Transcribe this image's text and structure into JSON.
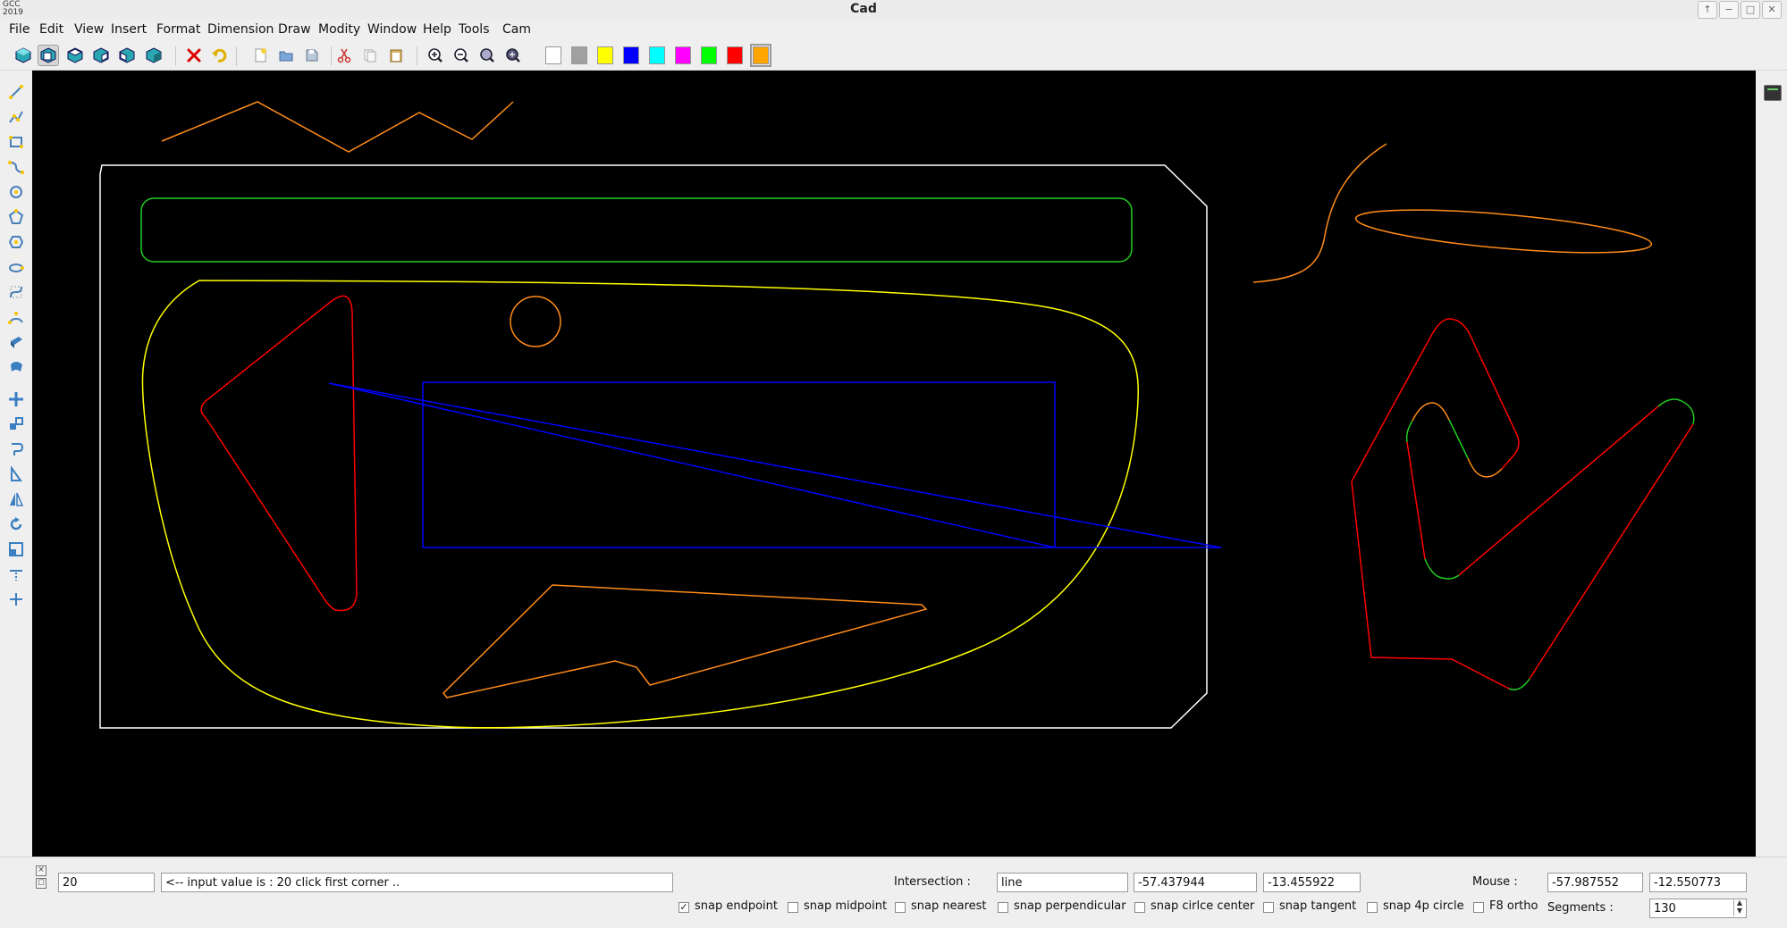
{
  "app": {
    "logo_top": "GCC",
    "logo_bottom": "2019",
    "title": "Cad"
  },
  "window_controls": [
    "↑",
    "−",
    "□",
    "✕"
  ],
  "menu": [
    "File",
    "Edit",
    "View",
    "Insert",
    "Format",
    "Dimension",
    "Draw",
    "Modity",
    "Window",
    "Help",
    "Tools",
    "Cam"
  ],
  "toolbar": {
    "view_icons": [
      "view-3d-icon",
      "view-front-icon",
      "view-top-icon",
      "view-right-icon",
      "view-left-icon",
      "view-iso-icon"
    ],
    "edit_icons": [
      "delete-icon",
      "undo-icon",
      "new-file-icon",
      "open-file-icon",
      "save-file-icon",
      "cut-icon",
      "copy-icon",
      "paste-icon"
    ],
    "zoom_icons": [
      "zoom-in-icon",
      "zoom-out-icon",
      "zoom-window-icon",
      "zoom-extents-icon"
    ],
    "colors": [
      "#ffffff",
      "#a0a0a0",
      "#ffff00",
      "#0000ff",
      "#00ffff",
      "#ff00ff",
      "#00ff00",
      "#ff0000",
      "#ffa500"
    ],
    "selected_color": "#ffa500"
  },
  "left_tools": [
    "line-icon",
    "polyline-icon",
    "rectangle-icon",
    "spline-icon",
    "circle-icon",
    "polygon-icon",
    "hexagon-icon",
    "ellipse-icon",
    "bezier-icon",
    "arc-icon",
    "extrude-icon",
    "revolve-icon",
    "move-icon",
    "copy-move-icon",
    "offset-icon",
    "mirror-icon",
    "flip-icon",
    "rotate-icon",
    "scale-icon",
    "trim-icon",
    "extend-icon"
  ],
  "command": {
    "input_value": "20",
    "message": "<-- input value is : 20 click first corner .."
  },
  "intersection": {
    "label": "Intersection :",
    "type": "line",
    "x": "-57.437944",
    "y": "-13.455922"
  },
  "mouse": {
    "label": "Mouse :",
    "x": "-57.987552",
    "y": "-12.550773"
  },
  "snaps": [
    {
      "label": "snap endpoint",
      "checked": true
    },
    {
      "label": "snap midpoint",
      "checked": false
    },
    {
      "label": "snap nearest",
      "checked": false
    },
    {
      "label": "snap perpendicular",
      "checked": false
    },
    {
      "label": "snap cirlce center",
      "checked": false
    },
    {
      "label": "snap tangent",
      "checked": false
    },
    {
      "label": "snap 4p circle",
      "checked": false
    },
    {
      "label": "F8 ortho",
      "checked": false
    }
  ],
  "segments": {
    "label": "Segments :",
    "value": "130"
  },
  "drawing_colors": {
    "white": "#ffffff",
    "green": "#22cc22",
    "yellow": "#ffff00",
    "red": "#ff0000",
    "orange": "#ff8c1a",
    "blue": "#0000ff"
  }
}
